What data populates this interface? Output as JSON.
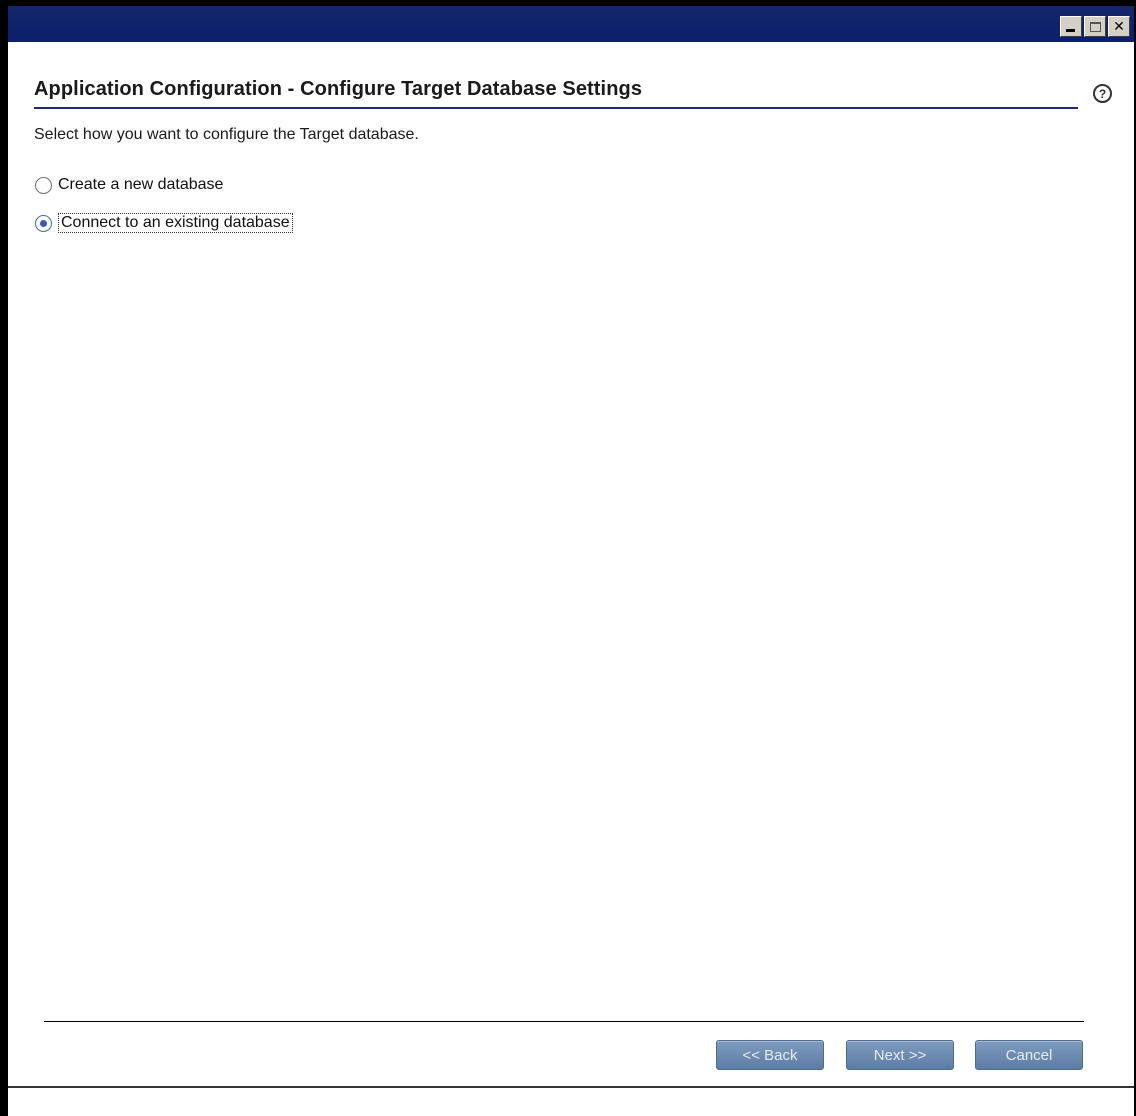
{
  "window": {
    "controls": {
      "minimize_icon": "minimize-icon",
      "maximize_icon": "maximize-icon",
      "close_icon": "close-icon",
      "close_glyph": "✕"
    }
  },
  "page": {
    "title": "Application Configuration - Configure Target Database Settings",
    "help_glyph": "?",
    "instructions": "Select how you want to configure the Target database."
  },
  "options": [
    {
      "label": "Create a new database",
      "selected": false
    },
    {
      "label": "Connect to an existing database",
      "selected": true
    }
  ],
  "buttons": {
    "back": "<< Back",
    "next": "Next >>",
    "cancel": "Cancel"
  },
  "colors": {
    "titlebar": "#0b1f6b",
    "button": "#6f8db5",
    "radio_selected": "#3b5db0"
  }
}
